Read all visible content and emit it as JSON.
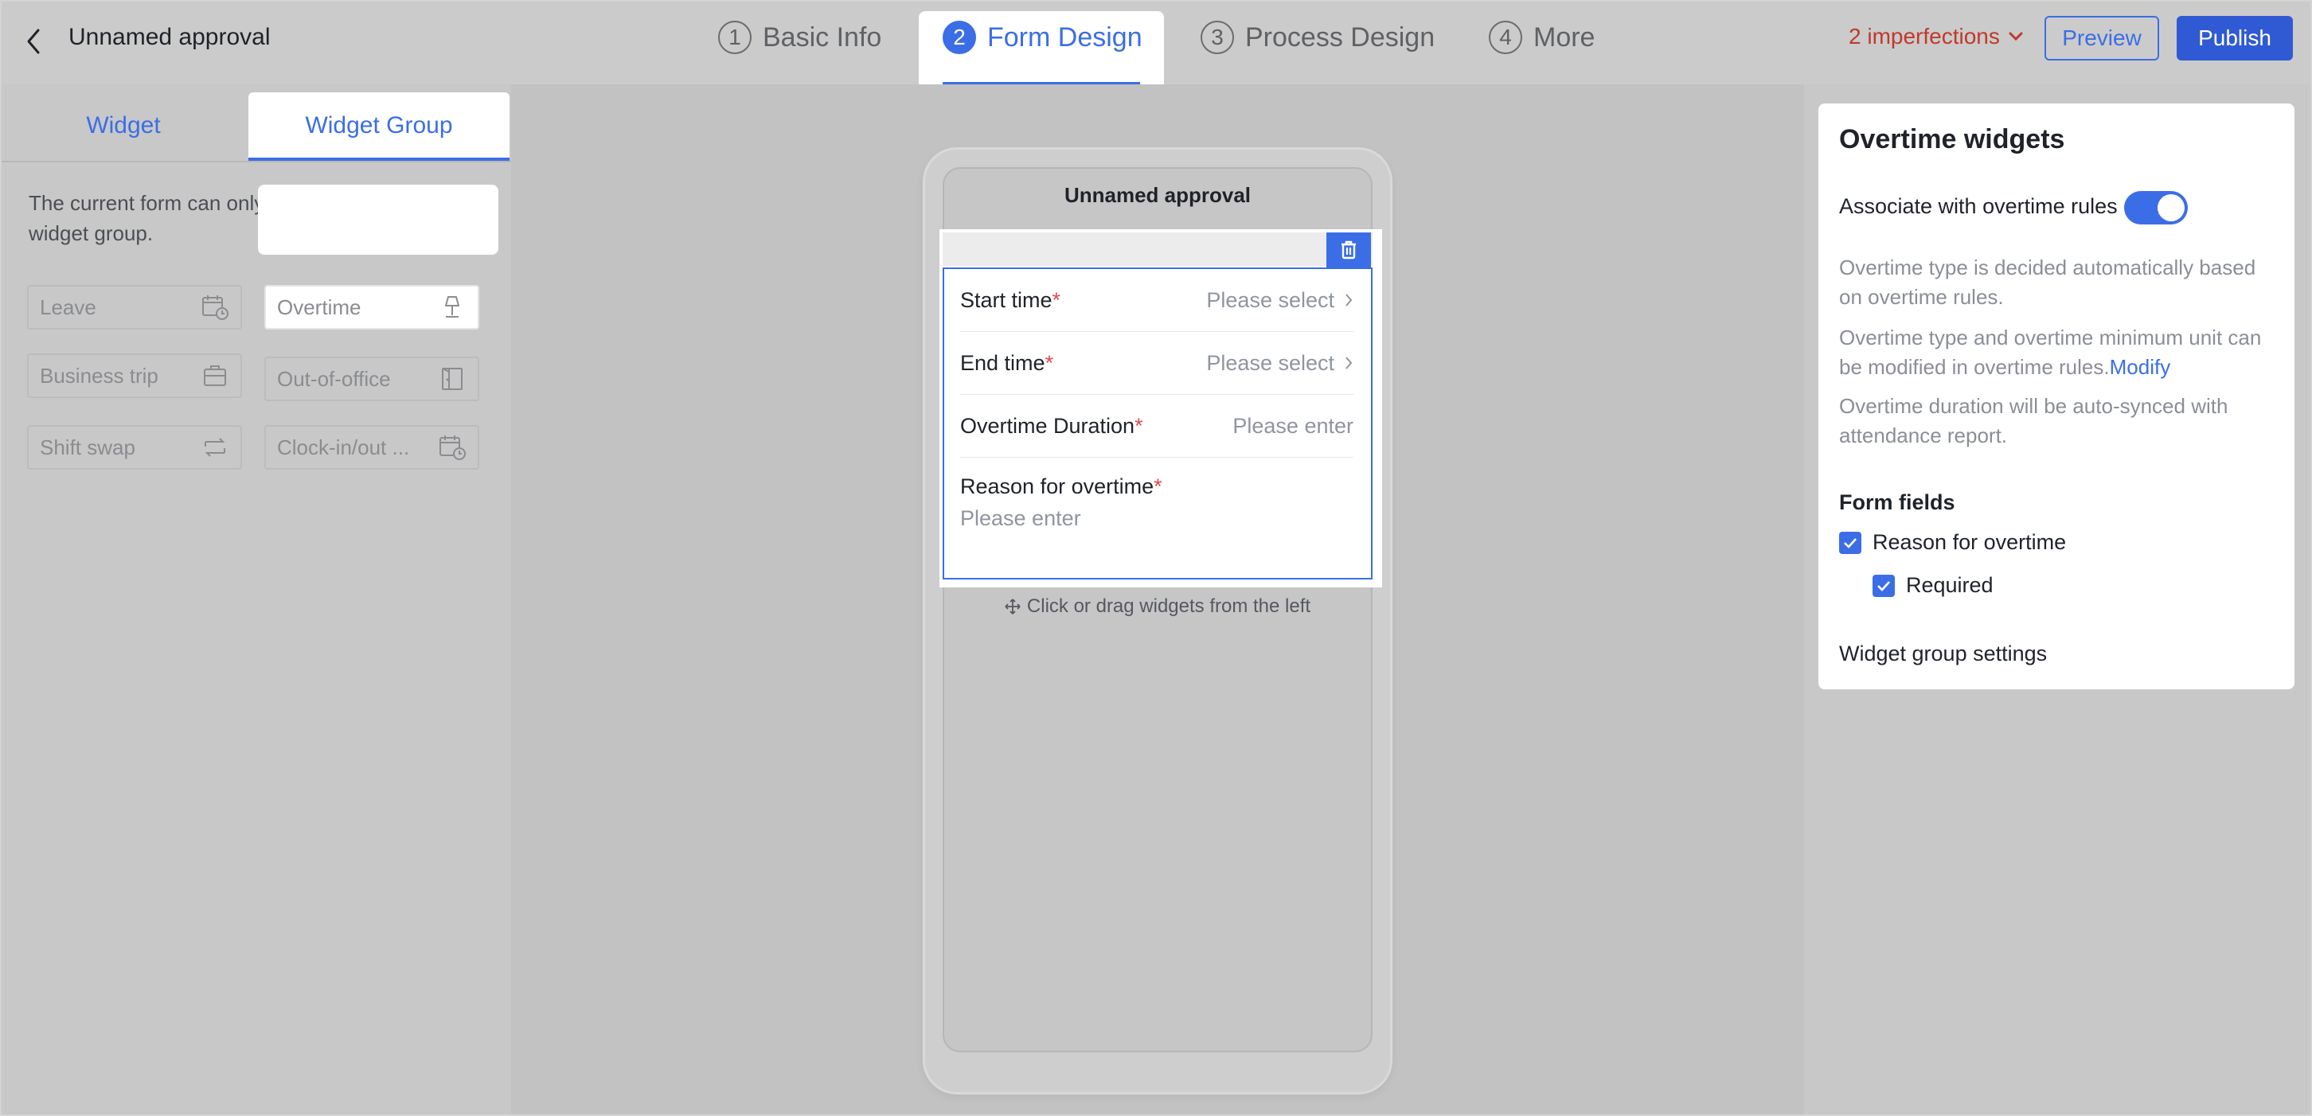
{
  "header": {
    "title": "Unnamed approval",
    "steps": [
      {
        "num": "1",
        "label": "Basic Info"
      },
      {
        "num": "2",
        "label": "Form Design"
      },
      {
        "num": "3",
        "label": "Process Design"
      },
      {
        "num": "4",
        "label": "More"
      }
    ],
    "active_step": "Form Design",
    "imperfections": "2 imperfections",
    "preview_label": "Preview",
    "publish_label": "Publish"
  },
  "left": {
    "tabs": [
      {
        "label": "Widget"
      },
      {
        "label": "Widget Group"
      }
    ],
    "active_tab": "Widget Group",
    "hint": "The current form can only add at most one widget group.",
    "widgets": [
      {
        "label": "Leave",
        "icon": "calendar-clock-icon"
      },
      {
        "label": "Overtime",
        "icon": "lamp-icon"
      },
      {
        "label": "Business trip",
        "icon": "suitcase-icon"
      },
      {
        "label": "Out-of-office",
        "icon": "door-icon"
      },
      {
        "label": "Shift swap",
        "icon": "swap-icon"
      },
      {
        "label": "Clock-in/out ...",
        "icon": "calendar-clock-icon"
      }
    ]
  },
  "canvas": {
    "phone_title": "Unnamed approval",
    "fields": [
      {
        "label": "Start time",
        "required": "*",
        "value": "Please select"
      },
      {
        "label": "End time",
        "required": "*",
        "value": "Please select"
      },
      {
        "label": "Overtime Duration",
        "required": "*",
        "value": "Please enter"
      }
    ],
    "reason": {
      "label": "Reason for overtime",
      "required": "*",
      "placeholder": "Please enter"
    },
    "drag_hint": "Click or drag widgets from the left"
  },
  "right": {
    "title": "Overtime widgets",
    "associate_label": "Associate with overtime rules",
    "associate_on": true,
    "desc1": "Overtime type is decided automatically based on overtime rules.",
    "desc2": "Overtime type and overtime minimum unit can be modified in overtime rules.",
    "modify_link": "Modify",
    "desc3": "Overtime duration will be auto-synced with attendance report.",
    "form_fields_title": "Form fields",
    "checkbox_reason": "Reason for overtime",
    "checkbox_required": "Required",
    "settings_label": "Widget group settings"
  },
  "colors": {
    "accent": "#3b6ee6",
    "publish": "#2f5ad3",
    "warning": "#c0392b",
    "required": "#e5484d"
  }
}
